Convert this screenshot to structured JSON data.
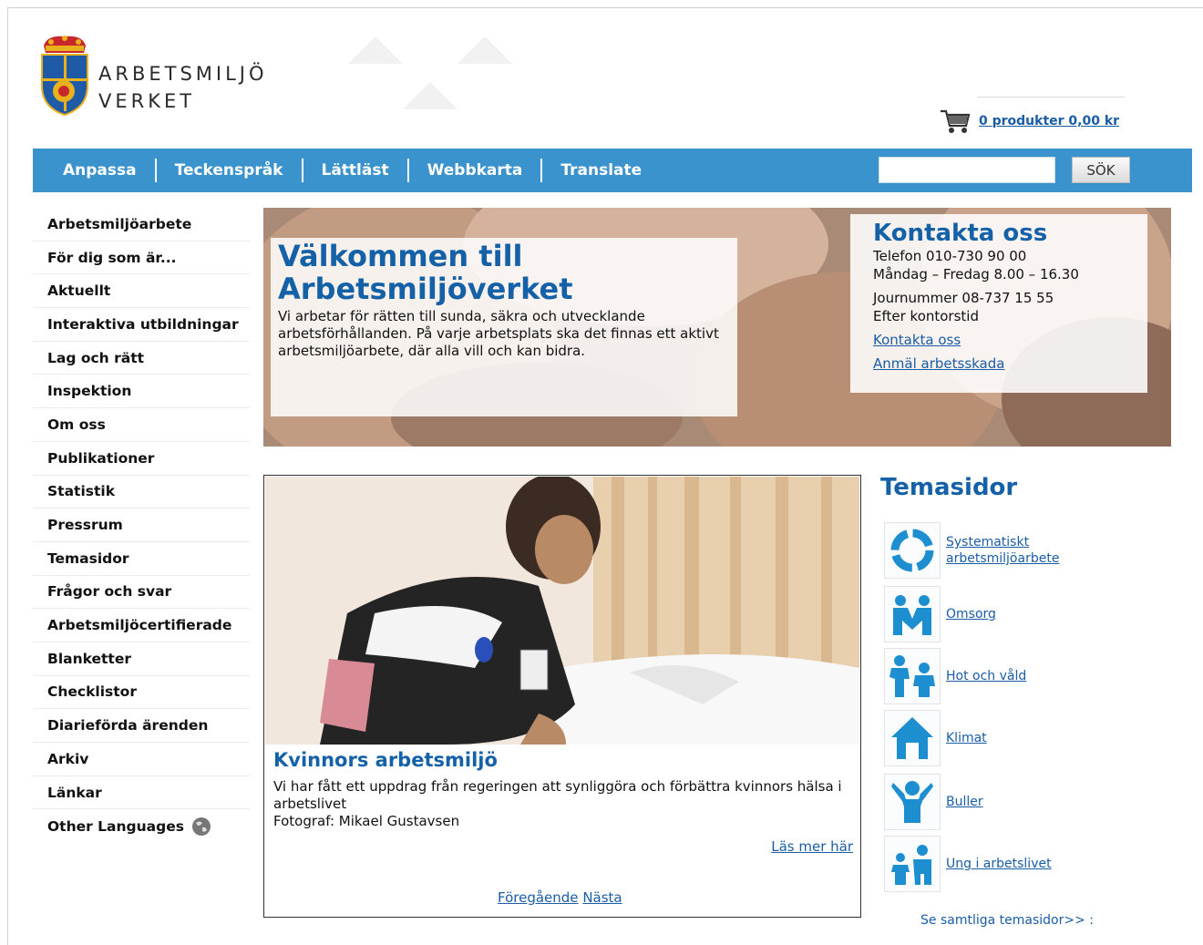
{
  "header": {
    "logo_line1": "ARBETSMILJÖ",
    "logo_line2": "VERKET",
    "cart_label": "0 produkter 0,00 kr"
  },
  "topnav": {
    "links": [
      "Anpassa",
      "Teckenspråk",
      "Lättläst",
      "Webbkarta",
      "Translate"
    ],
    "search_value": "",
    "search_button": "SÖK"
  },
  "sidebar": {
    "items": [
      "Arbetsmiljöarbete",
      "För dig som är...",
      "Aktuellt",
      "Interaktiva utbildningar",
      "Lag och rätt",
      "Inspektion",
      "Om oss",
      "Publikationer",
      "Statistik",
      "Pressrum",
      "Temasidor",
      "Frågor och svar",
      "Arbetsmiljöcertifierade",
      "Blanketter",
      "Checklistor",
      "Diarieförda ärenden",
      "Arkiv",
      "Länkar",
      "Other Languages"
    ]
  },
  "hero": {
    "welcome_title_1": "Välkommen till",
    "welcome_title_2": "Arbetsmiljöverket",
    "welcome_text": "Vi arbetar för rätten till sunda, säkra och utvecklande arbetsförhållanden. På varje arbetsplats ska det finnas ett aktivt arbetsmiljöarbete, där alla vill och kan bidra.",
    "contact_title": "Kontakta oss",
    "contact_phone": "Telefon 010-730 90 00",
    "contact_hours": "Måndag – Fredag 8.00 – 16.30",
    "contact_journal": "Journummer 08-737 15 55",
    "contact_after": "Efter kontorstid",
    "contact_link": "Kontakta oss",
    "report_link": "Anmäl arbetsskada"
  },
  "article": {
    "title": "Kvinnors arbetsmiljö",
    "text": "Vi har fått ett uppdrag från regeringen att synliggöra och förbättra kvinnors hälsa i arbetslivet",
    "photographer": "Fotograf: Mikael Gustavsen",
    "read_more": "Läs mer här",
    "prev": "Föregående",
    "next": "Nästa"
  },
  "themes": {
    "title": "Temasidor",
    "items": [
      {
        "label_1": "Systematiskt",
        "label_2": "arbetsmiljöarbete",
        "icon": "cycle-icon"
      },
      {
        "label_1": "Omsorg",
        "label_2": "",
        "icon": "care-icon"
      },
      {
        "label_1": "Hot och våld",
        "label_2": "",
        "icon": "threat-icon"
      },
      {
        "label_1": "Klimat",
        "label_2": "",
        "icon": "house-icon"
      },
      {
        "label_1": "Buller",
        "label_2": "",
        "icon": "noise-icon"
      },
      {
        "label_1": "Ung i arbetslivet",
        "label_2": "",
        "icon": "youth-icon"
      }
    ],
    "all_link": "Se samtliga temasidor>> :"
  },
  "colors": {
    "nav_blue": "#3a93cc",
    "heading_blue": "#1561a8",
    "link_blue": "#1a5da6"
  }
}
